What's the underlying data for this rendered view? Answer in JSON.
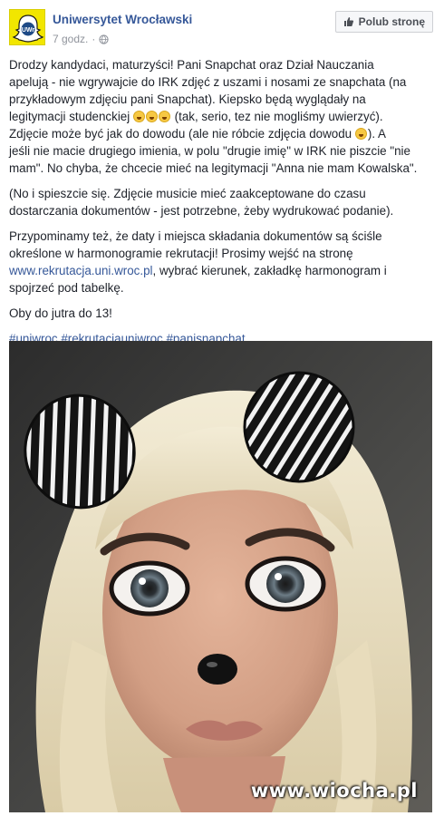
{
  "header": {
    "page_name": "Uniwersytet Wrocławski",
    "timestamp": "7 godz.",
    "like_page_label": "Polub stronę",
    "avatar_text": "UWr"
  },
  "post": {
    "p1_l1": "Drodzy kandydaci, maturzyści! Pani Snapchat oraz Dział Nauczania",
    "p1_l2": "apelują - nie wgrywajcie do IRK zdjęć z uszami i nosami ze snapchata (na",
    "p1_l3": "przykładowym zdjęciu pani Snapchat). Kiepsko będą wyglądały na",
    "p1_l4a": "legitymacji studenckiej ",
    "p1_l4b": " (tak, serio, tez nie mogliśmy uwierzyć).",
    "p1_l5a": "Zdjęcie może być jak do dowodu (ale nie róbcie zdjęcia dowodu ",
    "p1_l5b": "). A",
    "p1_l6": "jeśli nie macie drugiego imienia, w polu \"drugie imię\" w IRK nie piszcie \"nie",
    "p1_l7": "mam\". No chyba, że chcecie mieć na legitymacji \"Anna nie mam Kowalska\".",
    "p2_l1": "(No i spieszcie się. Zdjęcie musicie mieć zaakceptowane do czasu",
    "p2_l2": "dostarczania dokumentów - jest potrzebne, żeby wydrukować podanie).",
    "p3_l1": "Przypominamy też, że daty i miejsca składania dokumentów są ściśle",
    "p3_l2": "określone w harmonogramie rekrutacji! Prosimy wejść na stronę",
    "p3_link": "www.rekrutacja.uni.wroc.pl",
    "p3_l3b": ", wybrać kierunek, zakładkę harmonogram i",
    "p3_l4": "spojrzeć pod tabelkę.",
    "p4": "Oby do jutra do 13!",
    "hashtags": [
      "#uniwroc",
      "#rekrutacjauniwroc",
      "#panisnapchat"
    ]
  },
  "photo": {
    "watermark": "www.wiocha.pl"
  },
  "icons": {
    "globe": "globe-icon",
    "thumb": "thumbs-up-icon",
    "emoji": "laughing-emoji-icon"
  },
  "colors": {
    "link": "#365899",
    "avatar_bg": "#f2e600"
  }
}
